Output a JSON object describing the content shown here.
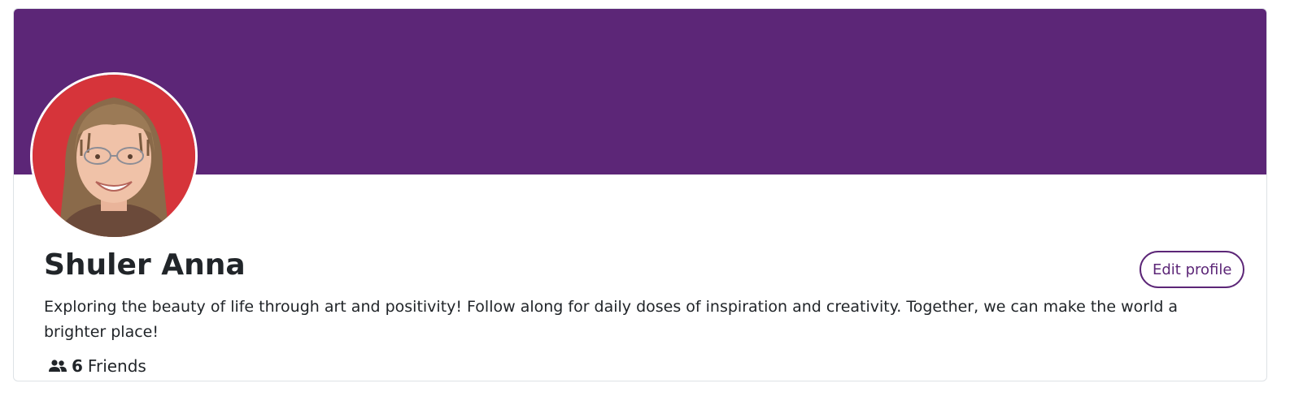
{
  "profile": {
    "name": "Shuler Anna",
    "bio": "Exploring the beauty of life through art and positivity! Follow along for daily doses of inspiration and creativity. Together, we can make the world a brighter place!",
    "friends_count": "6",
    "friends_label": "Friends",
    "edit_label": "Edit profile",
    "avatar_icon": "profile-photo"
  },
  "colors": {
    "cover": "#5c2677",
    "accent": "#5c2677",
    "avatar_background": "#d6343a",
    "text": "#212529"
  }
}
